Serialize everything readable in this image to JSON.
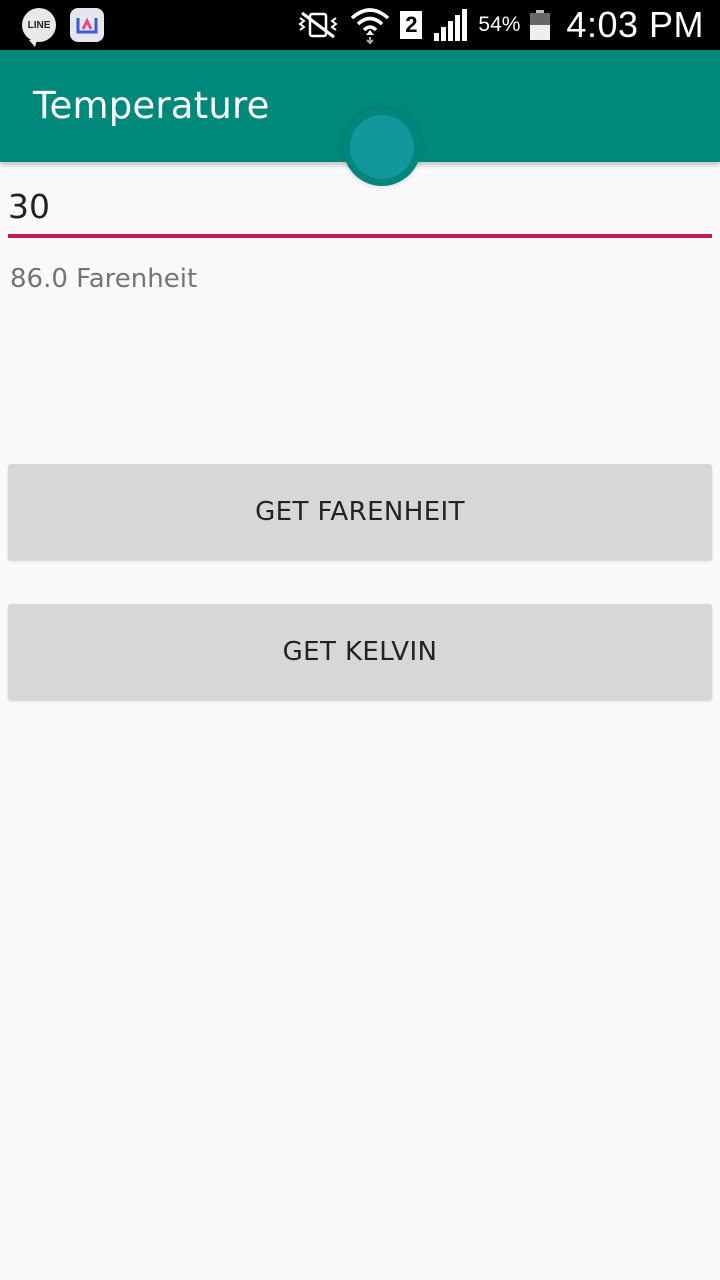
{
  "status_bar": {
    "notification_icons": [
      "line-app-icon",
      "app-icon"
    ],
    "line_text": "LINE",
    "sim_slot": "2",
    "battery_percent": "54%",
    "battery_level": 0.54,
    "time": "4:03 PM"
  },
  "app_bar": {
    "title": "Temperature",
    "background_color": "#00897b"
  },
  "form": {
    "input_value": "30",
    "accent_color": "#c2185b",
    "result_text": "86.0 Farenheit"
  },
  "buttons": {
    "fahrenheit_label": "GET FARENHEIT",
    "kelvin_label": "GET KELVIN"
  }
}
